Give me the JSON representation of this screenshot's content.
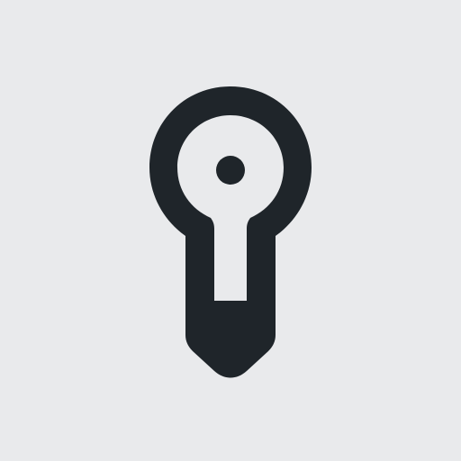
{
  "background_color": "#E9EAEC",
  "icon": {
    "name": "key-bulb-icon",
    "stroke_color": "#1F252A",
    "fill_color": "#E9EAEC"
  }
}
